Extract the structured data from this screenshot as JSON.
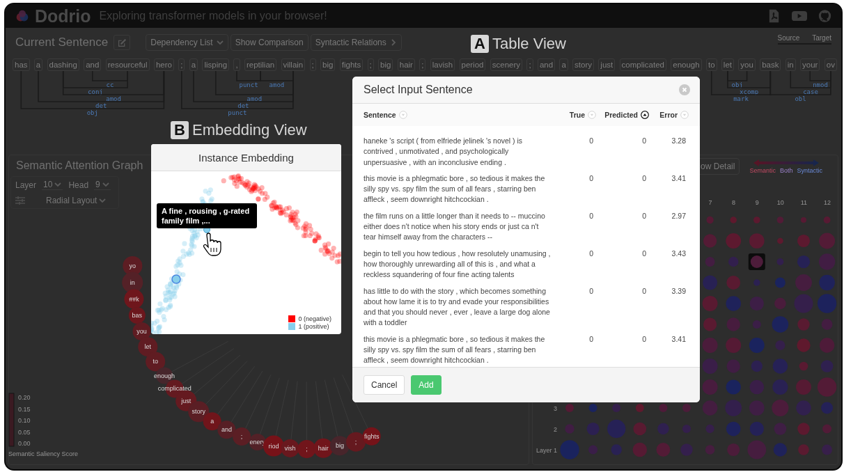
{
  "app": {
    "title": "Dodrio",
    "subtitle": "Exploring transformer models in your browser!"
  },
  "sentence_bar": {
    "heading": "Current Sentence",
    "buttons": [
      {
        "label": "Dependency List",
        "kind": "dropdown"
      },
      {
        "label": "Show Comparison",
        "kind": "plain"
      },
      {
        "label": "Syntactic Relations",
        "kind": "next"
      }
    ],
    "legend": [
      "Source",
      "Target"
    ]
  },
  "tokens": [
    "has",
    "a",
    "dashing",
    "and",
    "resourceful",
    "hero",
    ";",
    "a",
    "lisping",
    ",",
    "reptilian",
    "villain",
    ";",
    "big",
    "fights",
    ";",
    "big",
    "hair",
    ";",
    "lavish",
    "period",
    "scenery",
    ";",
    "and",
    "a",
    "story",
    "just",
    "complicated",
    "enough",
    "to",
    "let",
    "you",
    "bask",
    "in",
    "your",
    "ov"
  ],
  "dependency_labels": [
    "cc",
    "conj",
    "amod",
    "det",
    "obj",
    "punct",
    "amod",
    "amod",
    "det",
    "punct",
    "obj",
    "xcomp",
    "mark",
    "nmod",
    "case",
    "obl"
  ],
  "attention_graph": {
    "title": "Semantic Attention Graph",
    "layer_label": "Layer",
    "layer": "10",
    "head_label": "Head",
    "head": "9",
    "layout": "Radial Layout",
    "nodes": [
      "yo",
      "in",
      "##k",
      "bas",
      "you",
      "let",
      "to",
      "enough",
      "complicated",
      "just",
      "story",
      "a",
      "and",
      ";",
      "enery",
      "riod",
      "vish",
      ";",
      "hair",
      "big",
      ";",
      "fights"
    ],
    "legend": {
      "ticks": [
        "0.20",
        "0.15",
        "0.10",
        "0.05",
        "0.00"
      ],
      "title": "Semantic Saliency Score"
    }
  },
  "head_matrix": {
    "button": "ow Detail",
    "legend": [
      "Semantic",
      "Both",
      "Syntactic"
    ],
    "columns": [
      "7",
      "8",
      "9",
      "10",
      "11",
      "12"
    ],
    "rows": [
      "3",
      "2",
      "Layer 1"
    ]
  },
  "callouts": [
    {
      "letter": "A",
      "label": "Table View"
    },
    {
      "letter": "B",
      "label": "Embedding View"
    }
  ],
  "embedding": {
    "title": "Instance Embedding",
    "tooltip": "A fine , rousing , g-rated family film ,...",
    "legend": [
      {
        "label": "0 (negative)",
        "color": "#ff0000"
      },
      {
        "label": "1 (positive)",
        "color": "#87ceeb"
      }
    ]
  },
  "dialog": {
    "title": "Select Input Sentence",
    "columns": [
      {
        "label": "Sentence",
        "sorted": false
      },
      {
        "label": "True",
        "sorted": false
      },
      {
        "label": "Predicted",
        "sorted": true
      },
      {
        "label": "Error",
        "sorted": false
      }
    ],
    "rows": [
      {
        "sentence": "haneke 's script ( from elfriede jelinek 's novel ) is contrived , unmotivated , and psychologically unpersuasive , with an inconclusive ending .",
        "true": "0",
        "predicted": "0",
        "error": "3.28"
      },
      {
        "sentence": "this movie is a phlegmatic bore , so tedious it makes the silly spy vs. spy film the sum of all fears , starring ben affleck , seem downright hitchcockian .",
        "true": "0",
        "predicted": "0",
        "error": "3.41"
      },
      {
        "sentence": "the film runs on a little longer than it needs to -- muccino either does n't notice when his story ends or just ca n't tear himself away from the characters --",
        "true": "0",
        "predicted": "0",
        "error": "2.97"
      },
      {
        "sentence": "begin to tell you how tedious , how resolutely unamusing , how thoroughly unrewarding all of this is , and what a reckless squandering of four fine acting talents",
        "true": "0",
        "predicted": "0",
        "error": "3.43"
      },
      {
        "sentence": "has little to do with the story , which becomes something about how lame it is to try and evade your responsibilities and that you should never , ever , leave a large dog alone with a toddler",
        "true": "0",
        "predicted": "0",
        "error": "3.39"
      },
      {
        "sentence": "this movie is a phlegmatic bore , so tedious it makes the silly spy vs. spy film the sum of all fears , starring ben affleck , seem downright hitchcockian .",
        "true": "0",
        "predicted": "0",
        "error": "3.41"
      }
    ],
    "buttons": [
      {
        "label": "Cancel",
        "kind": "secondary"
      },
      {
        "label": "Add",
        "kind": "primary"
      }
    ]
  }
}
